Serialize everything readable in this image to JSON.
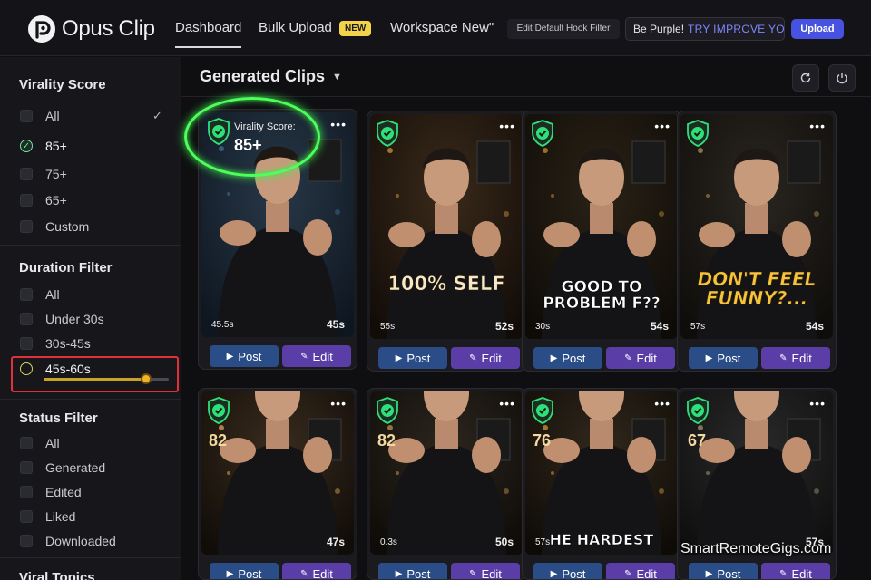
{
  "brand": {
    "name": "Opus Clip"
  },
  "nav": {
    "dashboard": "Dashboard",
    "bulk_upload": "Bulk Upload",
    "new_badge": "NEW",
    "workspace": "Workspace New\"",
    "hook_filter": "Edit Default Hook Filter",
    "prompt_text": "Be Purple!",
    "prompt_cta": "TRY IMPROVE YO",
    "upload": "Upload"
  },
  "sidebar": {
    "virality": {
      "title": "Virality Score",
      "options": [
        "All",
        "85+",
        "75+",
        "65+",
        "Custom"
      ],
      "selected": "85+"
    },
    "duration": {
      "title": "Duration Filter",
      "options": [
        "All",
        "Under 30s",
        "30s-45s",
        "45s-60s"
      ],
      "selected": "45s-60s",
      "slider_level": 0.82
    },
    "status": {
      "title": "Status Filter",
      "options": [
        "All",
        "Generated",
        "Edited",
        "Liked",
        "Downloaded"
      ]
    },
    "viral_topics": {
      "title": "Viral Topics"
    }
  },
  "main": {
    "title": "Generated Clips"
  },
  "clips": [
    {
      "score_label": "Virality Score:",
      "score": "85+",
      "dur_left": "45.5s",
      "dur_right": "45s",
      "caption": ""
    },
    {
      "score": "",
      "dur_left": "55s",
      "dur_right": "52s",
      "caption": "100% SELF"
    },
    {
      "score": "",
      "dur_left": "30s",
      "dur_right": "54s",
      "caption": "GOOD TO PROBLEM F??"
    },
    {
      "score": "",
      "dur_left": "57s",
      "dur_right": "54s",
      "caption": "DON'T FEEL FUNNY?..."
    },
    {
      "score": "82",
      "dur_left": "",
      "dur_right": "47s",
      "caption": ""
    },
    {
      "score": "82",
      "dur_left": "0.3s",
      "dur_right": "50s",
      "caption": ""
    },
    {
      "score": "76",
      "dur_left": "57s",
      "dur_right": "",
      "caption": "HE HARDEST"
    },
    {
      "score": "67",
      "dur_left": "",
      "dur_right": "57s",
      "caption": ""
    }
  ],
  "card_actions": {
    "post": "Post",
    "edit": "Edit"
  },
  "watermark": "SmartRemoteGigs.com",
  "colors": {
    "post": "#2b4d87",
    "edit": "#5b3da8",
    "accent": "#4753e0",
    "highlight_ring": "#4dff5a",
    "highlight_box": "#e0303a",
    "new_badge": "#f3d34a"
  }
}
